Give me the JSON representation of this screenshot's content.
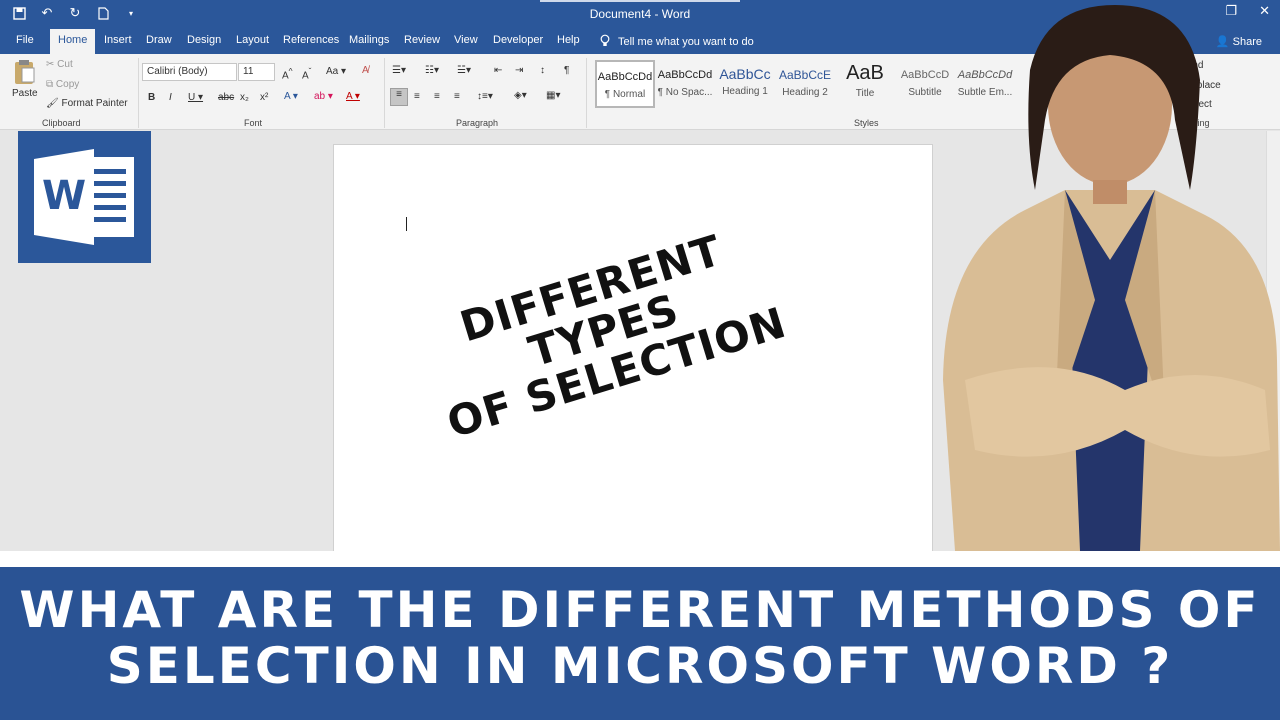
{
  "window": {
    "title": "Document4  -  Word"
  },
  "tabs": [
    "File",
    "Home",
    "Insert",
    "Draw",
    "Design",
    "Layout",
    "References",
    "Mailings",
    "Review",
    "View",
    "Developer",
    "Help"
  ],
  "tell_me": "Tell me what you want to do",
  "share": "Share",
  "clipboard": {
    "paste": "Paste",
    "cut": "Cut",
    "copy": "Copy",
    "format_painter": "Format Painter",
    "label": "Clipboard"
  },
  "font": {
    "family": "Calibri (Body)",
    "size": "11",
    "label": "Font"
  },
  "paragraph": {
    "label": "Paragraph"
  },
  "styles": {
    "label": "Styles",
    "items": [
      {
        "sample": "AaBbCcDd",
        "name": "¶ Normal"
      },
      {
        "sample": "AaBbCcDd",
        "name": "¶ No Spac..."
      },
      {
        "sample": "AaBbCc",
        "name": "Heading 1"
      },
      {
        "sample": "AaBbCcE",
        "name": "Heading 2"
      },
      {
        "sample": "AaB",
        "name": "Title"
      },
      {
        "sample": "AaBbCcD",
        "name": "Subtitle"
      },
      {
        "sample": "AaBbCcDd",
        "name": "Subtle Em..."
      }
    ]
  },
  "editing": {
    "find": "Find",
    "replace": "Replace",
    "select": "Select",
    "label": "Editing"
  },
  "document": {
    "overlay_line1": "DIFFERENT TYPES",
    "overlay_line2": "OF SELECTION"
  },
  "banner": {
    "line1": "WHAT ARE THE DIFFERENT METHODS OF",
    "line2": "SELECTION IN MICROSOFT WORD ?"
  },
  "colors": {
    "word_blue": "#2b579a",
    "banner_blue": "#2a5394"
  }
}
